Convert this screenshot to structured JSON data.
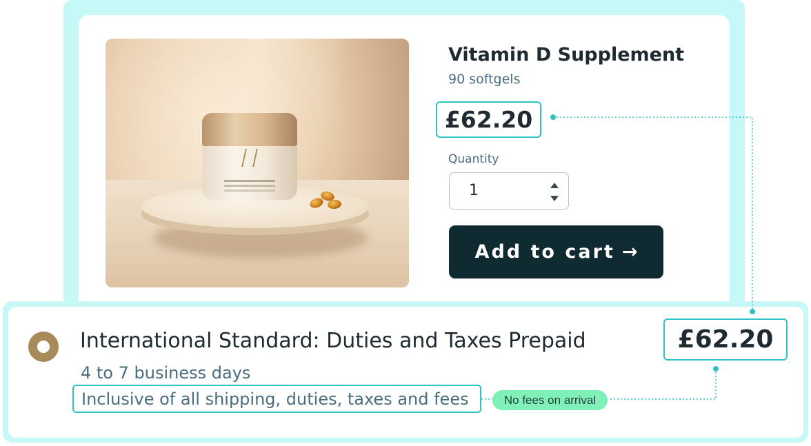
{
  "product": {
    "title": "Vitamin D Supplement",
    "subtitle": "90 softgels",
    "price": "£62.20",
    "quantity_label": "Quantity",
    "quantity_value": "1",
    "add_to_cart_label": "Add to cart",
    "add_to_cart_arrow": "→",
    "image_icon": "vitamin-jar-photo"
  },
  "shipping": {
    "option_title": "International Standard: Duties and Taxes Prepaid",
    "delivery_time": "4 to 7 business days",
    "inclusive_note": "Inclusive of all shipping, duties, taxes and fees",
    "badge": "No fees on arrival",
    "price": "£62.20",
    "selected": true
  },
  "colors": {
    "frame": "#c5f8f6",
    "highlight_border": "#2fc2c4",
    "button_bg": "#0f2a31",
    "badge_bg": "#7ef0b8",
    "radio": "#a88a5a",
    "text_dark": "#1f2b30",
    "text_muted": "#4a6d7e"
  }
}
